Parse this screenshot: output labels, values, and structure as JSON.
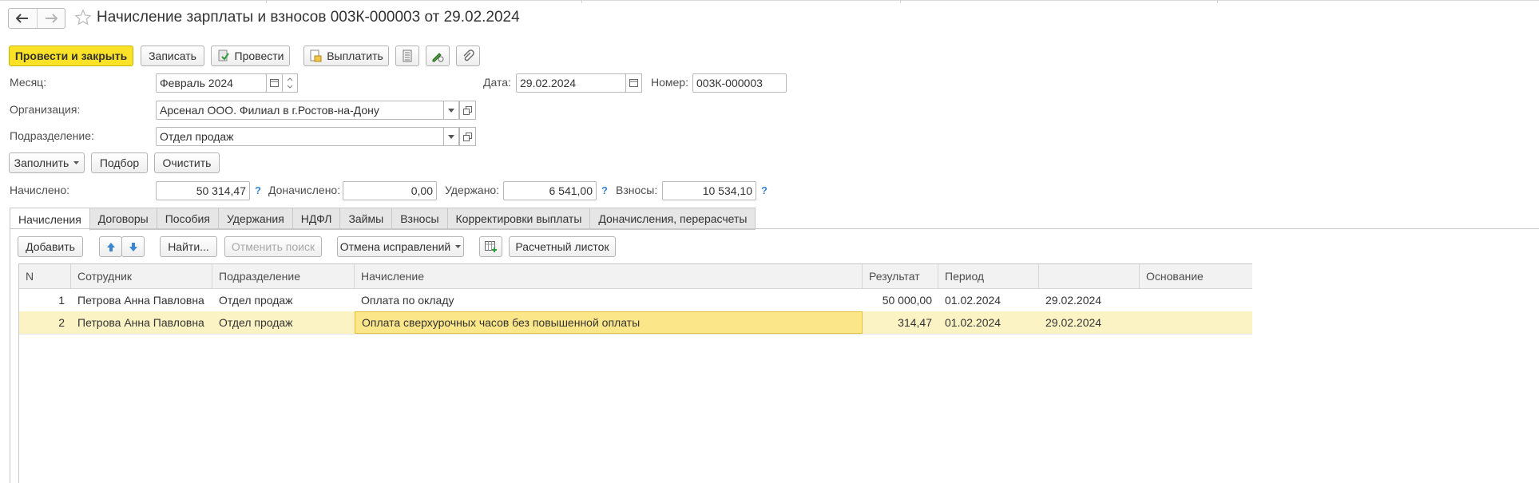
{
  "title": "Начисление зарплаты и взносов 003К-000003 от 29.02.2024",
  "toolbar": {
    "post_close": "Провести и закрыть",
    "save": "Записать",
    "post": "Провести",
    "pay": "Выплатить"
  },
  "form": {
    "month_label": "Месяц:",
    "month_value": "Февраль 2024",
    "date_label": "Дата:",
    "date_value": "29.02.2024",
    "number_label": "Номер:",
    "number_value": "003К-000003",
    "org_label": "Организация:",
    "org_value": "Арсенал ООО. Филиал в г.Ростов-на-Дону",
    "dept_label": "Подразделение:",
    "dept_value": "Отдел продаж"
  },
  "actions": {
    "fill": "Заполнить",
    "pick": "Подбор",
    "clear": "Очистить"
  },
  "totals": {
    "accrued_label": "Начислено:",
    "accrued_value": "50 314,47",
    "extra_label": "Доначислено:",
    "extra_value": "0,00",
    "withheld_label": "Удержано:",
    "withheld_value": "6 541,00",
    "contrib_label": "Взносы:",
    "contrib_value": "10 534,10",
    "help": "?"
  },
  "tabs": [
    "Начисления",
    "Договоры",
    "Пособия",
    "Удержания",
    "НДФЛ",
    "Займы",
    "Взносы",
    "Корректировки выплаты",
    "Доначисления, перерасчеты"
  ],
  "table_toolbar": {
    "add": "Добавить",
    "find": "Найти...",
    "cancel_search": "Отменить поиск",
    "cancel_corrections": "Отмена исправлений",
    "payslip": "Расчетный листок"
  },
  "table": {
    "columns": [
      "N",
      "Сотрудник",
      "Подразделение",
      "Начисление",
      "Результат",
      "Период",
      "",
      "Основание"
    ],
    "rows": [
      [
        "1",
        "Петрова Анна Павловна",
        "Отдел продаж",
        "Оплата по окладу",
        "50 000,00",
        "01.02.2024",
        "29.02.2024",
        ""
      ],
      [
        "2",
        "Петрова Анна Павловна",
        "Отдел продаж",
        "Оплата сверхурочных часов без повышенной оплаты",
        "314,47",
        "01.02.2024",
        "29.02.2024",
        ""
      ]
    ]
  },
  "colors": {
    "primary_button": "#fbe227",
    "selected_row": "#fcf3c5",
    "focused_cell": "#fbe68a",
    "help_blue": "#3b86c8"
  }
}
